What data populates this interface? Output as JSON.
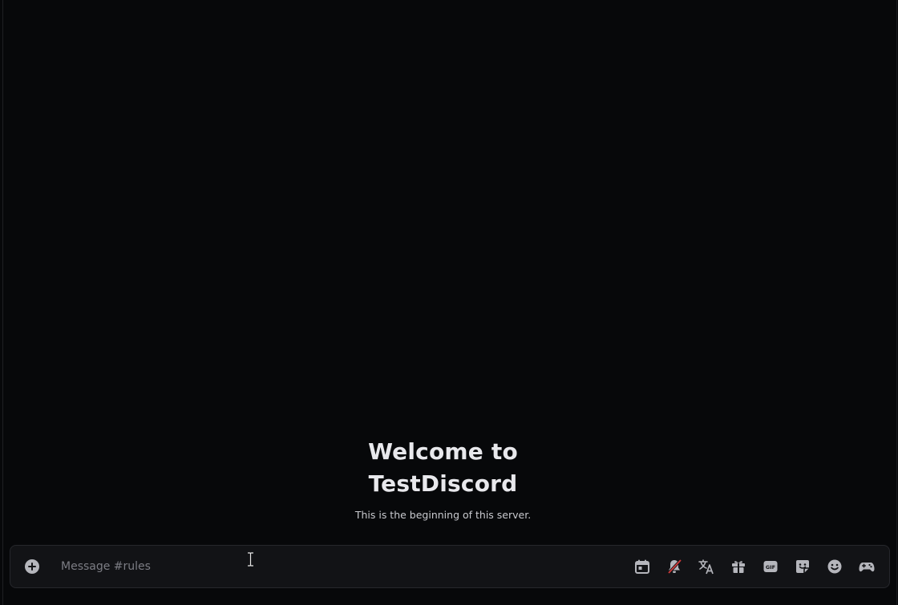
{
  "welcome": {
    "title_line1": "Welcome to",
    "title_line2": "TestDiscord",
    "subtitle": "This is the beginning of this server."
  },
  "composer": {
    "placeholder": "Message #rules",
    "value": "",
    "tools": [
      {
        "name": "calendar-icon",
        "label": "Schedule"
      },
      {
        "name": "notifications-muted-icon",
        "label": "Notifications off"
      },
      {
        "name": "translate-icon",
        "label": "Translate"
      },
      {
        "name": "gift-icon",
        "label": "Gift"
      },
      {
        "name": "gif-icon",
        "label": "GIF"
      },
      {
        "name": "sticker-icon",
        "label": "Sticker"
      },
      {
        "name": "emoji-icon",
        "label": "Emoji"
      },
      {
        "name": "gamepad-icon",
        "label": "Activities"
      }
    ]
  },
  "colors": {
    "background": "#07080a",
    "composer_bg": "#121316",
    "icon": "#b5b6bc",
    "muted_slash": "#d03a3a",
    "title": "#e8e8ec"
  }
}
